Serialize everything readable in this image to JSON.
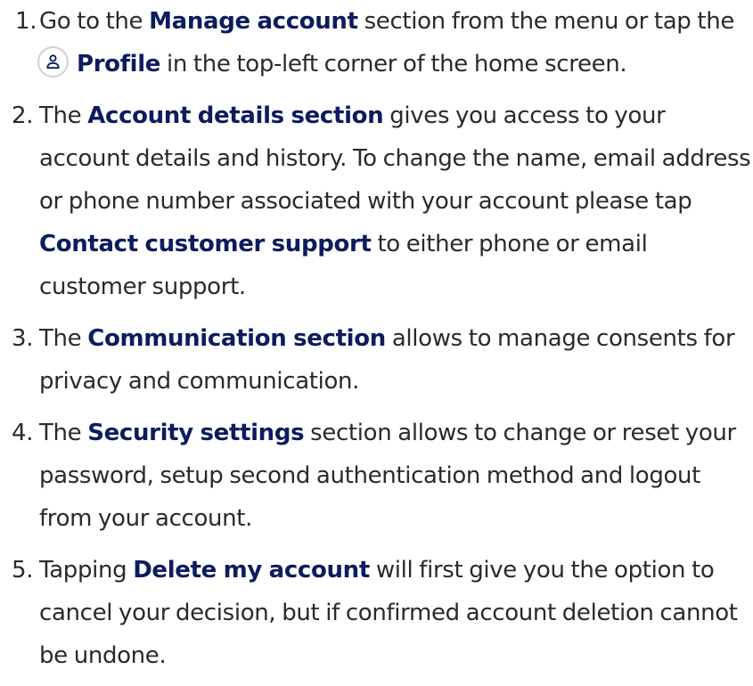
{
  "steps": [
    {
      "number": "1.",
      "a": "Go to the ",
      "b": "Manage account",
      "c": " section from the menu or tap the",
      "icon": "profile-icon",
      "d": "Profile",
      "e": " in the top-left corner of the home screen."
    },
    {
      "number": "2.",
      "a": "The ",
      "b": "Account details section",
      "c": " gives you access to your account details and history. To change the name, email address or phone number associated with your account please tap ",
      "d": "Contact customer support",
      "e": " to either phone or email customer support."
    },
    {
      "number": "3.",
      "a": "The ",
      "b": "Communication section",
      "c": " allows to manage consents for privacy and communication."
    },
    {
      "number": "4.",
      "a": "The ",
      "b": "Security settings",
      "c": " section allows to change or reset your password, setup second authentication method and logout from your account."
    },
    {
      "number": "5.",
      "a": "Tapping ",
      "b": "Delete my account",
      "c": " will first give you the option to cancel your decision, but if confirmed account deletion cannot be undone."
    }
  ],
  "colors": {
    "text": "#2a2a2a",
    "highlight": "#0c1c5e",
    "icon_border": "#cfcfd6"
  }
}
